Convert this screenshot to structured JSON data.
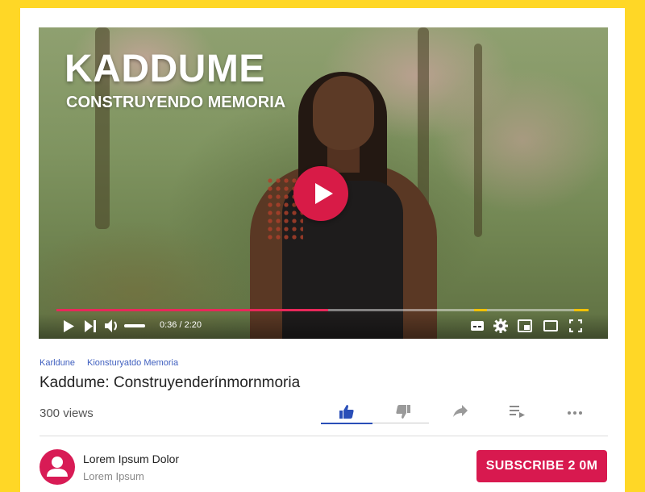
{
  "video": {
    "overlay_title": "KADDUME",
    "overlay_subtitle": "CONSTRUYENDO MEMORIA",
    "time_display": "0:36 / 2:20",
    "progress_fraction": 0.511,
    "volume_fraction": 1.0
  },
  "breadcrumb": [
    "Karldune",
    "Kionsturyatdo Memoria"
  ],
  "page_title": "Kaddume: Construyenderínmornmoria",
  "views": "300 views",
  "actions": [
    "like-icon",
    "dislike-icon",
    "share-icon",
    "add-to-playlist-icon",
    "more-icon"
  ],
  "channel": {
    "name": "Lorem Ipsum Dolor",
    "subtitle": "Lorem Ipsum"
  },
  "subscribe_label": "SUBSCRIBE 2 0M",
  "colors": {
    "background": "#FFD726",
    "accent": "#D81B4F",
    "link": "#3F5FBF",
    "progress": "#E8285A",
    "marker": "#F2C100"
  }
}
